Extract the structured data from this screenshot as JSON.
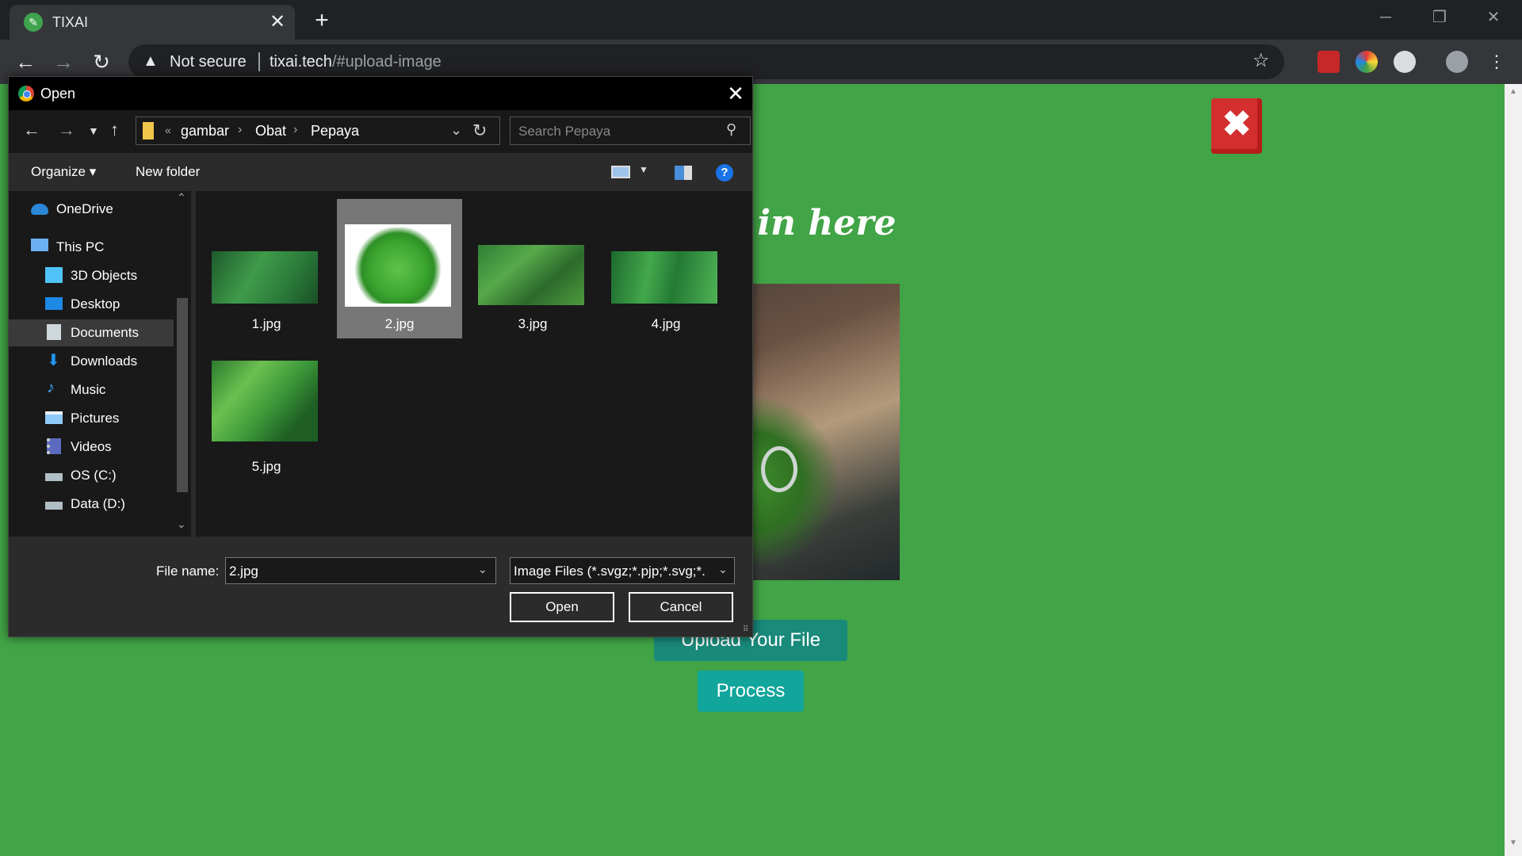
{
  "browser": {
    "tab_title": "TIXAI",
    "tab_close": "✕",
    "new_tab": "+",
    "security_label": "Not secure",
    "url_host": "tixai.tech",
    "url_path": "/#upload-image"
  },
  "page": {
    "heading": "image in here",
    "close_glyph": "✖",
    "upload_button": "Upload Your File",
    "process_button": "Process",
    "accent_color": "#41a446"
  },
  "dialog": {
    "title": "Open",
    "breadcrumb": [
      "gambar",
      "Obat",
      "Pepaya"
    ],
    "search_placeholder": "Search Pepaya",
    "organize_label": "Organize ▾",
    "new_folder_label": "New folder",
    "help_glyph": "?",
    "nav_items": [
      {
        "label": "OneDrive",
        "icon": "onedrive-icon"
      },
      {
        "label": "This PC",
        "icon": "pc-icon"
      },
      {
        "label": "3D Objects",
        "icon": "cube-icon"
      },
      {
        "label": "Desktop",
        "icon": "desktop-icon"
      },
      {
        "label": "Documents",
        "icon": "documents-icon"
      },
      {
        "label": "Downloads",
        "icon": "download-icon"
      },
      {
        "label": "Music",
        "icon": "music-icon"
      },
      {
        "label": "Pictures",
        "icon": "pictures-icon"
      },
      {
        "label": "Videos",
        "icon": "videos-icon"
      },
      {
        "label": "OS (C:)",
        "icon": "drive-icon"
      },
      {
        "label": "Data (D:)",
        "icon": "drive-icon"
      }
    ],
    "files": [
      {
        "name": "1.jpg"
      },
      {
        "name": "2.jpg"
      },
      {
        "name": "3.jpg"
      },
      {
        "name": "4.jpg"
      },
      {
        "name": "5.jpg"
      }
    ],
    "selected_file": "2.jpg",
    "file_name_label": "File name:",
    "file_name_value": "2.jpg",
    "file_type_filter": "Image Files (*.svgz;*.pjp;*.svg;*.",
    "open_button": "Open",
    "cancel_button": "Cancel"
  }
}
